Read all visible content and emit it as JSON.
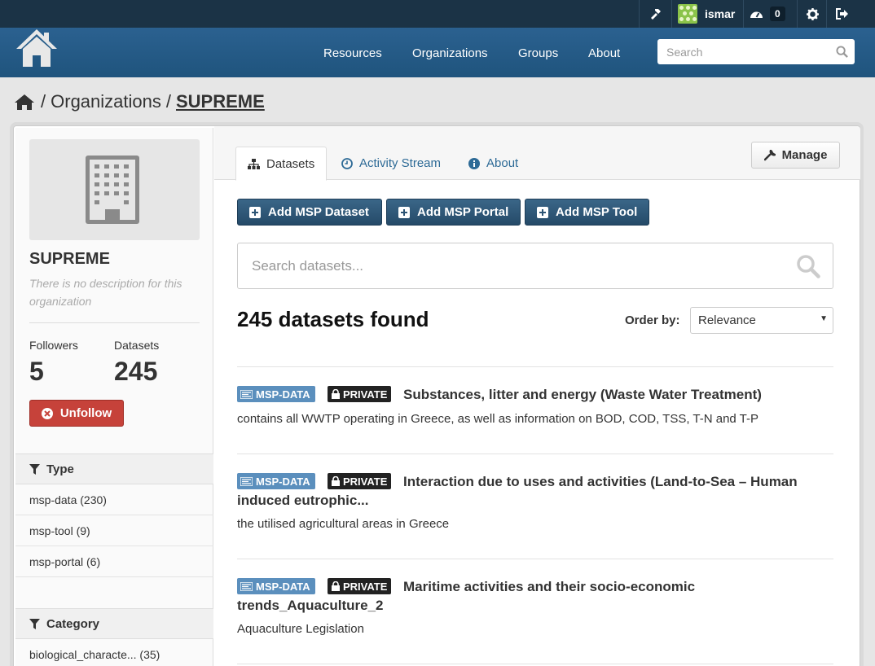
{
  "account": {
    "username": "ismar",
    "dashboard_count": "0",
    "icons": [
      "hammer-icon",
      "dashboard-icon",
      "gear-icon",
      "logout-icon"
    ]
  },
  "header": {
    "nav": [
      "Resources",
      "Organizations",
      "Groups",
      "About"
    ],
    "search_placeholder": "Search"
  },
  "breadcrumb": {
    "sep": "/",
    "organizations": "Organizations",
    "current": "SUPREME"
  },
  "sidebar": {
    "org_name": "SUPREME",
    "description": "There is no description for this organization",
    "followers_label": "Followers",
    "followers_value": "5",
    "datasets_label": "Datasets",
    "datasets_value": "245",
    "unfollow_label": "Unfollow",
    "facets": [
      {
        "title": "Type",
        "items": [
          "msp-data (230)",
          "msp-tool (9)",
          "msp-portal (6)"
        ]
      },
      {
        "title": "Category",
        "items": [
          "biological_characte... (35)"
        ]
      }
    ]
  },
  "main": {
    "tabs": [
      "Datasets",
      "Activity Stream",
      "About"
    ],
    "manage_label": "Manage",
    "actions": [
      "Add MSP Dataset",
      "Add MSP Portal",
      "Add MSP Tool"
    ],
    "search_placeholder": "Search datasets...",
    "found": "245 datasets found",
    "order_label": "Order by:",
    "order_value": "Relevance",
    "datasets": [
      {
        "type_label": "MSP-DATA",
        "private_label": "PRIVATE",
        "title": "Substances, litter and energy (Waste Water Treatment)",
        "description": "contains all WWTP operating in Greece, as well as information on BOD, COD, TSS, T-N and T-P"
      },
      {
        "type_label": "MSP-DATA",
        "private_label": "PRIVATE",
        "title": "Interaction due to uses and activities (Land-to-Sea – Human induced eutrophic...",
        "description": "the utilised agricultural areas in Greece"
      },
      {
        "type_label": "MSP-DATA",
        "private_label": "PRIVATE",
        "title": "Maritime activities and their socio-economic trends_Aquaculture_2",
        "description": "Aquaculture Legislation"
      }
    ]
  },
  "colors": {
    "account_bar": "#1b3346",
    "masthead": "#215a86",
    "primary_button": "#2c5474",
    "danger_button": "#c6423a",
    "msp_label": "#5b8fbd",
    "private_label": "#222222"
  }
}
